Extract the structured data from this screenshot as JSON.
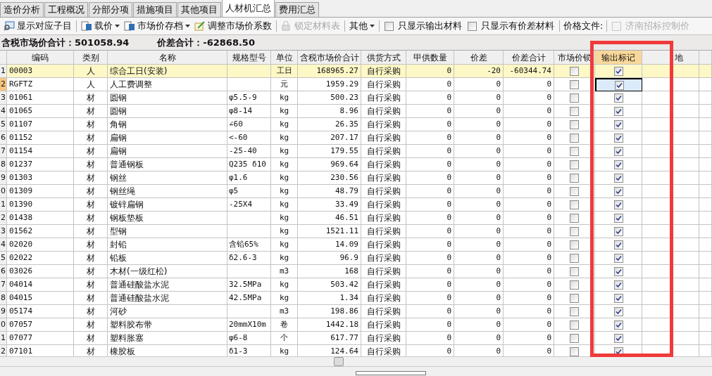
{
  "tabs": [
    {
      "label": "造价分析",
      "selected": false
    },
    {
      "label": "工程概况",
      "selected": false
    },
    {
      "label": "分部分项",
      "selected": false
    },
    {
      "label": "措施项目",
      "selected": false
    },
    {
      "label": "其他项目",
      "selected": false
    },
    {
      "label": "人材机汇总",
      "selected": true
    },
    {
      "label": "费用汇总",
      "selected": false
    }
  ],
  "toolbar": [
    {
      "kind": "button",
      "label": "显示对应子目",
      "disabled": false
    },
    {
      "kind": "separator"
    },
    {
      "kind": "dropdown",
      "label": "载价",
      "disabled": false
    },
    {
      "kind": "dropdown",
      "label": "市场价存档",
      "disabled": false
    },
    {
      "kind": "button",
      "label": "调整市场价系数",
      "disabled": false
    },
    {
      "kind": "separator"
    },
    {
      "kind": "button",
      "label": "锁定材料表",
      "disabled": true
    },
    {
      "kind": "separator"
    },
    {
      "kind": "dropdown",
      "label": "其他",
      "disabled": false
    },
    {
      "kind": "separator"
    },
    {
      "kind": "checkbox",
      "label": "只显示输出材料",
      "checked": false,
      "disabled": false
    },
    {
      "kind": "checkbox",
      "label": "只显示有价差材料",
      "checked": false,
      "disabled": false
    },
    {
      "kind": "separator"
    },
    {
      "kind": "label",
      "label": "价格文件:"
    },
    {
      "kind": "separator"
    },
    {
      "kind": "checkbox",
      "label": "济南招标控制价",
      "checked": false,
      "disabled": true
    }
  ],
  "summary": [
    "含税市场价合计：501058.94",
    "价差合计：-62868.50"
  ],
  "table": {
    "columns": [
      "编码",
      "类别",
      "名称",
      "规格型号",
      "单位",
      "含税市场价合计",
      "供货方式",
      "甲供数量",
      "价差",
      "价差合计",
      "市场价锁",
      "输出标记",
      "地"
    ],
    "rows": [
      {
        "num": "1",
        "code": "00003",
        "type": "人",
        "name": "综合工日(安装)",
        "spec": "",
        "unit": "工日",
        "total": "168965.27",
        "supply": "自行采购",
        "qty": "0",
        "diff": "-20",
        "diff_total": "-60344.74",
        "locked": false,
        "output": true,
        "highlighted": true,
        "selected": false
      },
      {
        "num": "2",
        "code": "RGFTZ",
        "type": "人",
        "name": "人工费调整",
        "spec": "",
        "unit": "元",
        "total": "1959.29",
        "supply": "自行采购",
        "qty": "0",
        "diff": "0",
        "diff_total": "0",
        "locked": false,
        "output": true,
        "highlighted": false,
        "selected": true
      },
      {
        "num": "3",
        "code": "01061",
        "type": "材",
        "name": "圆钢",
        "spec": "φ5.5-9",
        "unit": "kg",
        "total": "500.23",
        "supply": "自行采购",
        "qty": "0",
        "diff": "0",
        "diff_total": "0",
        "locked": false,
        "output": true,
        "highlighted": false,
        "selected": false
      },
      {
        "num": "4",
        "code": "01065",
        "type": "材",
        "name": "圆钢",
        "spec": "φ8-14",
        "unit": "kg",
        "total": "8.96",
        "supply": "自行采购",
        "qty": "0",
        "diff": "0",
        "diff_total": "0",
        "locked": false,
        "output": true,
        "highlighted": false,
        "selected": false
      },
      {
        "num": "5",
        "code": "01107",
        "type": "材",
        "name": "角钢",
        "spec": "∠60",
        "unit": "kg",
        "total": "26.35",
        "supply": "自行采购",
        "qty": "0",
        "diff": "0",
        "diff_total": "0",
        "locked": false,
        "output": true,
        "highlighted": false,
        "selected": false
      },
      {
        "num": "6",
        "code": "01152",
        "type": "材",
        "name": "扁钢",
        "spec": "<-60",
        "unit": "kg",
        "total": "207.17",
        "supply": "自行采购",
        "qty": "0",
        "diff": "0",
        "diff_total": "0",
        "locked": false,
        "output": true,
        "highlighted": false,
        "selected": false
      },
      {
        "num": "7",
        "code": "01154",
        "type": "材",
        "name": "扁钢",
        "spec": "-25-40",
        "unit": "kg",
        "total": "179.55",
        "supply": "自行采购",
        "qty": "0",
        "diff": "0",
        "diff_total": "0",
        "locked": false,
        "output": true,
        "highlighted": false,
        "selected": false
      },
      {
        "num": "8",
        "code": "01237",
        "type": "材",
        "name": "普通钢板",
        "spec": "Q235 δ10",
        "unit": "kg",
        "total": "969.64",
        "supply": "自行采购",
        "qty": "0",
        "diff": "0",
        "diff_total": "0",
        "locked": false,
        "output": true,
        "highlighted": false,
        "selected": false
      },
      {
        "num": "9",
        "code": "01303",
        "type": "材",
        "name": "钢丝",
        "spec": "φ1.6",
        "unit": "kg",
        "total": "230.56",
        "supply": "自行采购",
        "qty": "0",
        "diff": "0",
        "diff_total": "0",
        "locked": false,
        "output": true,
        "highlighted": false,
        "selected": false
      },
      {
        "num": "0",
        "code": "01309",
        "type": "材",
        "name": "钢丝绳",
        "spec": "φ5",
        "unit": "kg",
        "total": "48.79",
        "supply": "自行采购",
        "qty": "0",
        "diff": "0",
        "diff_total": "0",
        "locked": false,
        "output": true,
        "highlighted": false,
        "selected": false
      },
      {
        "num": "1",
        "code": "01390",
        "type": "材",
        "name": "镀锌扁钢",
        "spec": "-25X4",
        "unit": "kg",
        "total": "33.49",
        "supply": "自行采购",
        "qty": "0",
        "diff": "0",
        "diff_total": "0",
        "locked": false,
        "output": true,
        "highlighted": false,
        "selected": false
      },
      {
        "num": "2",
        "code": "01438",
        "type": "材",
        "name": "钢板垫板",
        "spec": "",
        "unit": "kg",
        "total": "46.51",
        "supply": "自行采购",
        "qty": "0",
        "diff": "0",
        "diff_total": "0",
        "locked": false,
        "output": true,
        "highlighted": false,
        "selected": false
      },
      {
        "num": "3",
        "code": "01562",
        "type": "材",
        "name": "型钢",
        "spec": "",
        "unit": "kg",
        "total": "1521.11",
        "supply": "自行采购",
        "qty": "0",
        "diff": "0",
        "diff_total": "0",
        "locked": false,
        "output": true,
        "highlighted": false,
        "selected": false
      },
      {
        "num": "4",
        "code": "02020",
        "type": "材",
        "name": "封铅",
        "spec": "含铅65%",
        "unit": "kg",
        "total": "14.09",
        "supply": "自行采购",
        "qty": "0",
        "diff": "0",
        "diff_total": "0",
        "locked": false,
        "output": true,
        "highlighted": false,
        "selected": false
      },
      {
        "num": "5",
        "code": "02022",
        "type": "材",
        "name": "铅板",
        "spec": "δ2.6-3",
        "unit": "kg",
        "total": "96.9",
        "supply": "自行采购",
        "qty": "0",
        "diff": "0",
        "diff_total": "0",
        "locked": false,
        "output": true,
        "highlighted": false,
        "selected": false
      },
      {
        "num": "6",
        "code": "03026",
        "type": "材",
        "name": "木材(一级红松)",
        "spec": "",
        "unit": "m3",
        "total": "168",
        "supply": "自行采购",
        "qty": "0",
        "diff": "0",
        "diff_total": "0",
        "locked": false,
        "output": true,
        "highlighted": false,
        "selected": false
      },
      {
        "num": "7",
        "code": "04014",
        "type": "材",
        "name": "普通硅酸盐水泥",
        "spec": "32.5MPa",
        "unit": "kg",
        "total": "503.42",
        "supply": "自行采购",
        "qty": "0",
        "diff": "0",
        "diff_total": "0",
        "locked": false,
        "output": true,
        "highlighted": false,
        "selected": false
      },
      {
        "num": "8",
        "code": "04015",
        "type": "材",
        "name": "普通硅酸盐水泥",
        "spec": "42.5MPa",
        "unit": "kg",
        "total": "1.34",
        "supply": "自行采购",
        "qty": "0",
        "diff": "0",
        "diff_total": "0",
        "locked": false,
        "output": true,
        "highlighted": false,
        "selected": false
      },
      {
        "num": "9",
        "code": "05174",
        "type": "材",
        "name": "河砂",
        "spec": "",
        "unit": "m3",
        "total": "198.86",
        "supply": "自行采购",
        "qty": "0",
        "diff": "0",
        "diff_total": "0",
        "locked": false,
        "output": true,
        "highlighted": false,
        "selected": false
      },
      {
        "num": "0",
        "code": "07057",
        "type": "材",
        "name": "塑料胶布带",
        "spec": "20mmX10m",
        "unit": "卷",
        "total": "1442.18",
        "supply": "自行采购",
        "qty": "0",
        "diff": "0",
        "diff_total": "0",
        "locked": false,
        "output": true,
        "highlighted": false,
        "selected": false
      },
      {
        "num": "1",
        "code": "07077",
        "type": "材",
        "name": "塑料胀塞",
        "spec": "φ6-8",
        "unit": "个",
        "total": "617.77",
        "supply": "自行采购",
        "qty": "0",
        "diff": "0",
        "diff_total": "0",
        "locked": false,
        "output": true,
        "highlighted": false,
        "selected": false
      },
      {
        "num": "2",
        "code": "07101",
        "type": "材",
        "name": "橡胶板",
        "spec": "δ1-3",
        "unit": "kg",
        "total": "124.64",
        "supply": "自行采购",
        "qty": "0",
        "diff": "0",
        "diff_total": "0",
        "locked": false,
        "output": true,
        "highlighted": false,
        "selected": false
      }
    ]
  }
}
